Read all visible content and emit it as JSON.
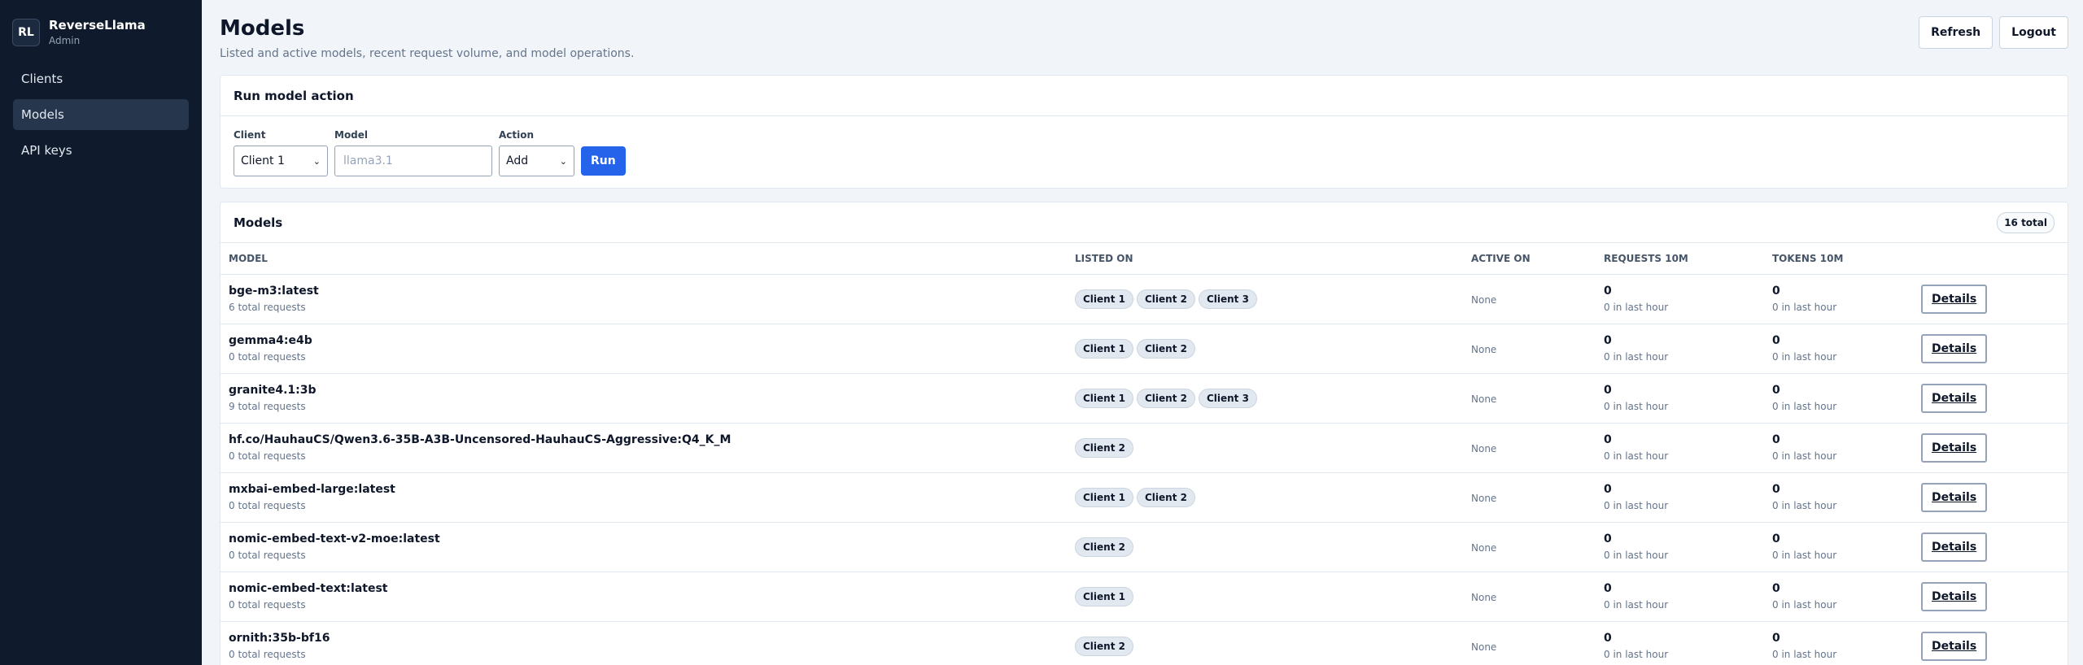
{
  "sidebar": {
    "avatar": "RL",
    "app_name": "ReverseLlama",
    "role": "Admin",
    "items": [
      {
        "label": "Clients",
        "active": false
      },
      {
        "label": "Models",
        "active": true
      },
      {
        "label": "API keys",
        "active": false
      }
    ]
  },
  "header": {
    "title": "Models",
    "subtitle": "Listed and active models, recent request volume, and model operations.",
    "refresh_label": "Refresh",
    "logout_label": "Logout"
  },
  "action_form": {
    "title": "Run model action",
    "client_label": "Client",
    "client_value": "Client 1",
    "model_label": "Model",
    "model_placeholder": "llama3.1",
    "action_label": "Action",
    "action_value": "Add",
    "run_label": "Run"
  },
  "models": {
    "title": "Models",
    "total_badge": "16 total",
    "columns": [
      "Model",
      "Listed on",
      "Active on",
      "Requests 10m",
      "Tokens 10m",
      ""
    ],
    "details_label": "Details",
    "rows": [
      {
        "name": "bge-m3:latest",
        "total": "6 total requests",
        "listed": [
          "Client 1",
          "Client 2",
          "Client 3"
        ],
        "active": "None",
        "requests": "0",
        "requests_sub": "0 in last hour",
        "tokens": "0",
        "tokens_sub": "0 in last hour"
      },
      {
        "name": "gemma4:e4b",
        "total": "0 total requests",
        "listed": [
          "Client 1",
          "Client 2"
        ],
        "active": "None",
        "requests": "0",
        "requests_sub": "0 in last hour",
        "tokens": "0",
        "tokens_sub": "0 in last hour"
      },
      {
        "name": "granite4.1:3b",
        "total": "9 total requests",
        "listed": [
          "Client 1",
          "Client 2",
          "Client 3"
        ],
        "active": "None",
        "requests": "0",
        "requests_sub": "0 in last hour",
        "tokens": "0",
        "tokens_sub": "0 in last hour"
      },
      {
        "name": "hf.co/HauhauCS/Qwen3.6-35B-A3B-Uncensored-HauhauCS-Aggressive:Q4_K_M",
        "total": "0 total requests",
        "listed": [
          "Client 2"
        ],
        "active": "None",
        "requests": "0",
        "requests_sub": "0 in last hour",
        "tokens": "0",
        "tokens_sub": "0 in last hour"
      },
      {
        "name": "mxbai-embed-large:latest",
        "total": "0 total requests",
        "listed": [
          "Client 1",
          "Client 2"
        ],
        "active": "None",
        "requests": "0",
        "requests_sub": "0 in last hour",
        "tokens": "0",
        "tokens_sub": "0 in last hour"
      },
      {
        "name": "nomic-embed-text-v2-moe:latest",
        "total": "0 total requests",
        "listed": [
          "Client 2"
        ],
        "active": "None",
        "requests": "0",
        "requests_sub": "0 in last hour",
        "tokens": "0",
        "tokens_sub": "0 in last hour"
      },
      {
        "name": "nomic-embed-text:latest",
        "total": "0 total requests",
        "listed": [
          "Client 1"
        ],
        "active": "None",
        "requests": "0",
        "requests_sub": "0 in last hour",
        "tokens": "0",
        "tokens_sub": "0 in last hour"
      },
      {
        "name": "ornith:35b-bf16",
        "total": "0 total requests",
        "listed": [
          "Client 2"
        ],
        "active": "None",
        "requests": "0",
        "requests_sub": "0 in last hour",
        "tokens": "0",
        "tokens_sub": "0 in last hour"
      }
    ]
  },
  "colors": {
    "sidebar_bg": "#0f1b2d",
    "sidebar_active": "#26364d",
    "accent": "#2563eb",
    "page_bg": "#f1f5f9"
  }
}
